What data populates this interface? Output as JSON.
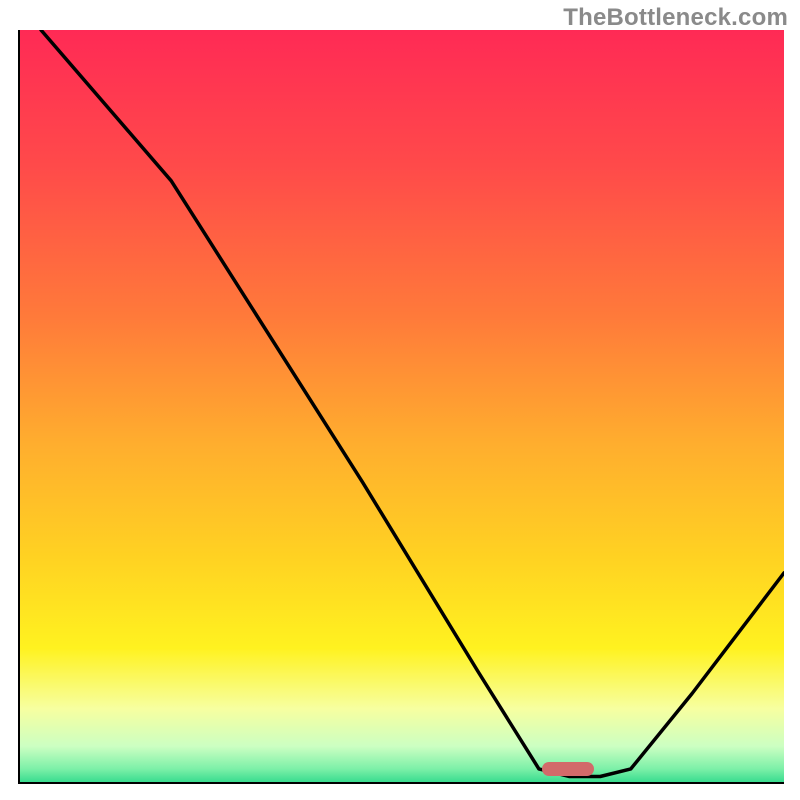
{
  "watermark": "TheBottleneck.com",
  "colors": {
    "gradient_top": "#ff2a55",
    "gradient_bottom": "#2fd98b",
    "curve": "#000000",
    "marker": "#d26a6a",
    "axes": "#000000"
  },
  "chart_data": {
    "type": "line",
    "title": "",
    "xlabel": "",
    "ylabel": "",
    "xlim": [
      0,
      100
    ],
    "ylim": [
      0,
      100
    ],
    "legend": false,
    "grid": false,
    "curve": [
      {
        "x": 3,
        "y": 100
      },
      {
        "x": 20,
        "y": 80
      },
      {
        "x": 25,
        "y": 72
      },
      {
        "x": 45,
        "y": 40
      },
      {
        "x": 60,
        "y": 15
      },
      {
        "x": 68,
        "y": 2
      },
      {
        "x": 72,
        "y": 1
      },
      {
        "x": 76,
        "y": 1
      },
      {
        "x": 80,
        "y": 2
      },
      {
        "x": 88,
        "y": 12
      },
      {
        "x": 100,
        "y": 28
      }
    ],
    "optimal_x": 74,
    "optimal_marker_color": "#d26a6a",
    "background_scale": {
      "top": "worst",
      "bottom": "best",
      "colors": [
        "#ff2a55",
        "#ff7a3a",
        "#ffd222",
        "#f7ffa0",
        "#2fd98b"
      ]
    }
  }
}
